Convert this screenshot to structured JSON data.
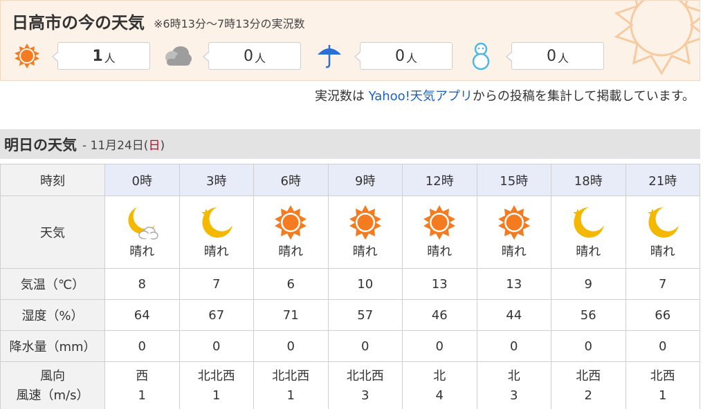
{
  "live": {
    "title": "日高市の今の天気",
    "note": "※6時13分〜7時13分の実況数",
    "unit": "人",
    "counters": [
      {
        "icon": "sun-icon",
        "count": "1"
      },
      {
        "icon": "cloud-icon",
        "count": "0"
      },
      {
        "icon": "umbrella-icon",
        "count": "0"
      },
      {
        "icon": "snowman-icon",
        "count": "0"
      }
    ]
  },
  "credit": {
    "prefix": "実況数は ",
    "link": "Yahoo!天気アプリ",
    "suffix": "からの投稿を集計して掲載しています。"
  },
  "tomorrow": {
    "title": "明日の天気",
    "date_prefix": "- 11月24日(",
    "weekday": "日",
    "date_suffix": ")"
  },
  "table": {
    "labels": {
      "time": "時刻",
      "weather": "天気",
      "temp": "気温（℃）",
      "humidity": "湿度（%）",
      "precip": "降水量（mm）",
      "wind_dir": "風向",
      "wind_speed": "風速（m/s）"
    },
    "hours": [
      {
        "time": "0時",
        "icon": "moon-cloud-icon",
        "weather": "晴れ",
        "temp": "8",
        "humidity": "64",
        "precip": "0",
        "wind_dir": "西",
        "wind_speed": "1"
      },
      {
        "time": "3時",
        "icon": "moon-icon",
        "weather": "晴れ",
        "temp": "7",
        "humidity": "67",
        "precip": "0",
        "wind_dir": "北北西",
        "wind_speed": "1"
      },
      {
        "time": "6時",
        "icon": "sun-icon",
        "weather": "晴れ",
        "temp": "6",
        "humidity": "71",
        "precip": "0",
        "wind_dir": "北北西",
        "wind_speed": "1"
      },
      {
        "time": "9時",
        "icon": "sun-icon",
        "weather": "晴れ",
        "temp": "10",
        "humidity": "57",
        "precip": "0",
        "wind_dir": "北北西",
        "wind_speed": "3"
      },
      {
        "time": "12時",
        "icon": "sun-icon",
        "weather": "晴れ",
        "temp": "13",
        "humidity": "46",
        "precip": "0",
        "wind_dir": "北",
        "wind_speed": "4"
      },
      {
        "time": "15時",
        "icon": "sun-icon",
        "weather": "晴れ",
        "temp": "13",
        "humidity": "44",
        "precip": "0",
        "wind_dir": "北",
        "wind_speed": "3"
      },
      {
        "time": "18時",
        "icon": "moon-icon",
        "weather": "晴れ",
        "temp": "9",
        "humidity": "56",
        "precip": "0",
        "wind_dir": "北西",
        "wind_speed": "2"
      },
      {
        "time": "21時",
        "icon": "moon-icon",
        "weather": "晴れ",
        "temp": "7",
        "humidity": "66",
        "precip": "0",
        "wind_dir": "北西",
        "wind_speed": "1"
      }
    ]
  },
  "colors": {
    "panel_bg": "#fdf2e8",
    "sun": "#f47b20",
    "moon": "#f5b800",
    "umbrella": "#2a6fd6",
    "snowman": "#4bb7e8",
    "link": "#1a62c9",
    "sunday": "#d0021b",
    "time_row": "#e8ecf8"
  }
}
